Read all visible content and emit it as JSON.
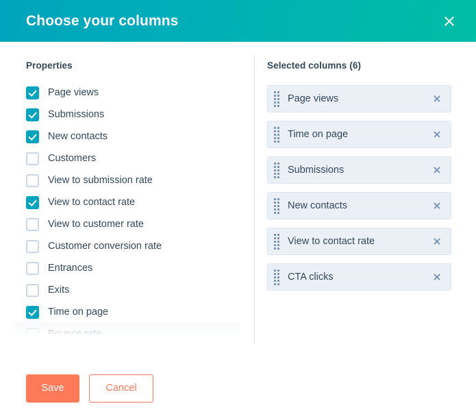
{
  "dialog": {
    "title": "Choose your columns",
    "close_icon": "close-icon"
  },
  "properties": {
    "heading": "Properties",
    "items": [
      {
        "label": "Page views",
        "checked": true
      },
      {
        "label": "Submissions",
        "checked": true
      },
      {
        "label": "New contacts",
        "checked": true
      },
      {
        "label": "Customers",
        "checked": false
      },
      {
        "label": "View to submission rate",
        "checked": false
      },
      {
        "label": "View to contact rate",
        "checked": true
      },
      {
        "label": "View to customer rate",
        "checked": false
      },
      {
        "label": "Customer conversion rate",
        "checked": false
      },
      {
        "label": "Entrances",
        "checked": false
      },
      {
        "label": "Exits",
        "checked": false
      },
      {
        "label": "Time on page",
        "checked": true
      },
      {
        "label": "Bounce rate",
        "checked": false,
        "hovered": true,
        "clipped": true
      }
    ]
  },
  "selected": {
    "heading": "Selected columns (6)",
    "count": 6,
    "items": [
      {
        "label": "Page views",
        "handle_icon": "drag-handle-icon",
        "remove_icon": "close-icon"
      },
      {
        "label": "Time on page",
        "handle_icon": "drag-handle-icon",
        "remove_icon": "close-icon"
      },
      {
        "label": "Submissions",
        "handle_icon": "drag-handle-icon",
        "remove_icon": "close-icon"
      },
      {
        "label": "New contacts",
        "handle_icon": "drag-handle-icon",
        "remove_icon": "close-icon"
      },
      {
        "label": "View to contact rate",
        "handle_icon": "drag-handle-icon",
        "remove_icon": "close-icon"
      },
      {
        "label": "CTA clicks",
        "handle_icon": "drag-handle-icon",
        "remove_icon": "close-icon"
      }
    ]
  },
  "footer": {
    "save_label": "Save",
    "cancel_label": "Cancel"
  },
  "colors": {
    "header_gradient_start": "#00a4bd",
    "header_gradient_end": "#00bda5",
    "checkbox_checked": "#00a4bd",
    "checkbox_border": "#cbd6e2",
    "text": "#33475b",
    "chip_background": "#eaf0f6",
    "chip_icon": "#7c98b6",
    "primary_button": "#ff7a59"
  }
}
